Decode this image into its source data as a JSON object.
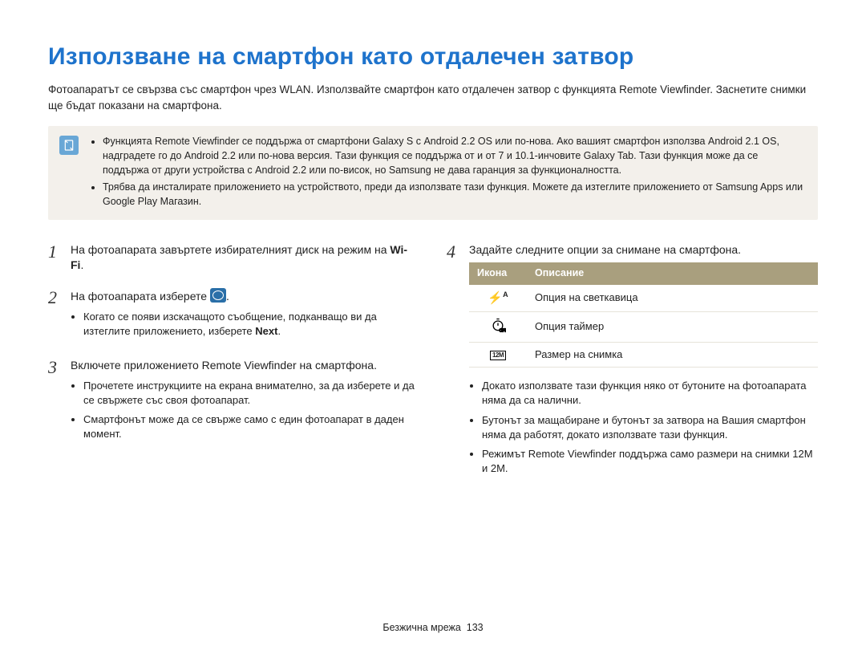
{
  "title": "Използване на смартфон като отдалечен затвор",
  "intro": "Фотоапаратът се свързва със смартфон чрез WLAN. Използвайте смартфон като отдалечен затвор с функцията Remote Viewfinder. Заснетите снимки ще бъдат показани на смартфона.",
  "note": {
    "bullets": [
      "Функцията Remote Viewfinder се поддържа от смартфони Galaxy S с Android 2.2 OS или по-нова. Ако вашият смартфон използва Android 2.1 OS, надградете го до Android 2.2 или по-нова версия. Тази функция се поддържа от и от 7 и 10.1-инчовите Galaxy Tab. Тази функция може да се поддържа от други устройства с Android 2.2 или по-висок, но Samsung не дава гаранция за функционалността.",
      "Трябва да инсталирате приложението на устройството, преди да използвате тази функция. Можете да изтеглите приложението от Samsung Apps или Google Play Магазин."
    ]
  },
  "left": {
    "steps": [
      {
        "num": "1",
        "text_pre": "На фотоапарата завъртете избирателният диск на режим на ",
        "bold": "Wi-Fi",
        "text_post": "."
      },
      {
        "num": "2",
        "text_pre": "На фотоапарата изберете ",
        "icon": true,
        "text_post": ".",
        "sub": [
          {
            "pre": "Когато се появи изскачащото съобщение, подканващо ви да изтеглите приложението, изберете ",
            "bold": "Next",
            "post": "."
          }
        ]
      },
      {
        "num": "3",
        "text_pre": "Включете приложението Remote Viewfinder на смартфона.",
        "sub": [
          {
            "pre": "Прочетете инструкциите на екрана внимателно, за да изберете и да се свържете със своя фотоапарат."
          },
          {
            "pre": "Смартфонът може да се свърже само с един фотоапарат в даден момент."
          }
        ]
      }
    ]
  },
  "right": {
    "step4": {
      "num": "4",
      "text": "Задайте следните опции за снимане на смартфона."
    },
    "table": {
      "headers": [
        "Икона",
        "Описание"
      ],
      "rows": [
        {
          "icon": "flash",
          "label_inline": "A",
          "desc": "Опция на светкавица"
        },
        {
          "icon": "timer",
          "desc": "Опция таймер"
        },
        {
          "icon": "box",
          "label_inline": "12M",
          "desc": "Размер на снимка"
        }
      ]
    },
    "bullets": [
      "Докато използвате тази функция няко от бутоните на фотоапарата няма да са налични.",
      "Бутонът за мащабиране и бутонът за затвора на Вашия смартфон няма да работят, докато използвате тази функция.",
      "Режимът Remote Viewfinder поддържа само размери на снимки 12M и 2M."
    ]
  },
  "footer": {
    "section": "Безжична мрежа",
    "page": "133"
  }
}
